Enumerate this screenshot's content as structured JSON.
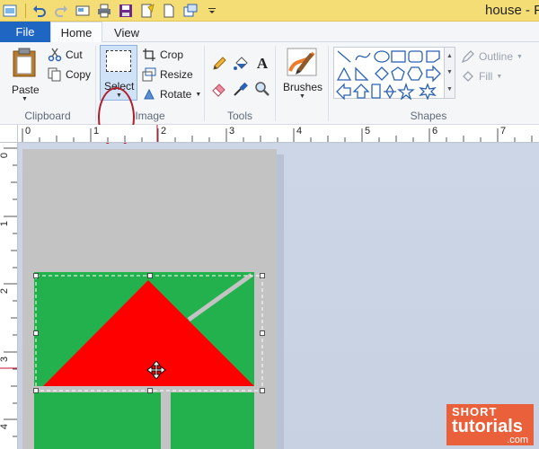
{
  "window": {
    "title": "house - P"
  },
  "tabs": {
    "file": "File",
    "home": "Home",
    "view": "View"
  },
  "clipboard": {
    "paste": "Paste",
    "cut": "Cut",
    "copy": "Copy",
    "label": "Clipboard"
  },
  "image": {
    "select": "Select",
    "crop": "Crop",
    "resize": "Resize",
    "rotate": "Rotate",
    "label": "Image"
  },
  "tools": {
    "label": "Tools"
  },
  "brushes": {
    "label": "Brushes"
  },
  "shapes": {
    "outline": "Outline",
    "fill": "Fill",
    "label": "Shapes"
  },
  "ruler": {
    "h_marks": [
      "0",
      "1",
      "2",
      "3",
      "4",
      "5",
      "6",
      "7"
    ],
    "v_marks": [
      "0",
      "1",
      "2",
      "3",
      "4"
    ]
  },
  "colors": {
    "grass": "#22b14c",
    "roof": "#ff0000",
    "line": "#c3c3c3",
    "accent": "#1f66c3",
    "title_bar": "#f5dd75"
  },
  "watermark": {
    "line1": "SHORT",
    "line2": "tutorials",
    "line3": ".com"
  }
}
